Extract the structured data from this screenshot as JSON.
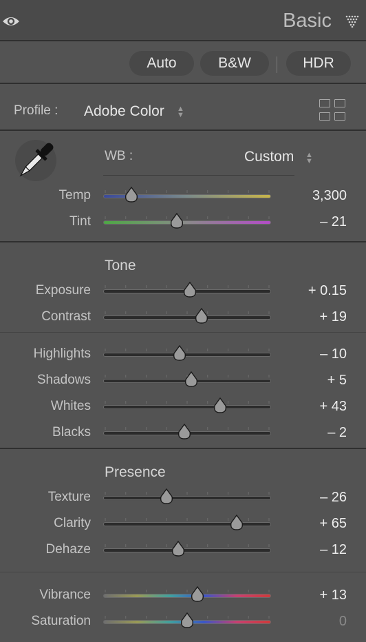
{
  "header": {
    "title": "Basic"
  },
  "auto_bar": {
    "auto_label": "Auto",
    "bw_label": "B&W",
    "hdr_label": "HDR"
  },
  "profile": {
    "label": "Profile :",
    "value": "Adobe Color"
  },
  "white_balance": {
    "label": "WB :",
    "value": "Custom"
  },
  "sliders": [
    {
      "label": "Temp",
      "value": "3,300",
      "position": 0.17,
      "track": "temp"
    },
    {
      "label": "Tint",
      "value": "– 21",
      "position": 0.44,
      "track": "tint"
    },
    {
      "label": "Exposure",
      "value": "+ 0.15",
      "position": 0.515,
      "track": "gray"
    },
    {
      "label": "Contrast",
      "value": "+ 19",
      "position": 0.585,
      "track": "gray"
    },
    {
      "label": "Highlights",
      "value": "– 10",
      "position": 0.455,
      "track": "gray"
    },
    {
      "label": "Shadows",
      "value": "+ 5",
      "position": 0.525,
      "track": "gray"
    },
    {
      "label": "Whites",
      "value": "+ 43",
      "position": 0.695,
      "track": "gray"
    },
    {
      "label": "Blacks",
      "value": "– 2",
      "position": 0.485,
      "track": "gray"
    },
    {
      "label": "Texture",
      "value": "– 26",
      "position": 0.375,
      "track": "gray"
    },
    {
      "label": "Clarity",
      "value": "+ 65",
      "position": 0.795,
      "track": "gray"
    },
    {
      "label": "Dehaze",
      "value": "– 12",
      "position": 0.445,
      "track": "gray"
    },
    {
      "label": "Vibrance",
      "value": "+ 13",
      "position": 0.56,
      "track": "color"
    },
    {
      "label": "Saturation",
      "value": "0",
      "position": 0.5,
      "track": "color"
    }
  ],
  "sections": {
    "tone": "Tone",
    "presence": "Presence"
  },
  "colors": {
    "panel_bg": "#535353",
    "separator": "#2f2f2f",
    "value_text": "#ececec",
    "zero_value_text": "#8a8a8a"
  }
}
